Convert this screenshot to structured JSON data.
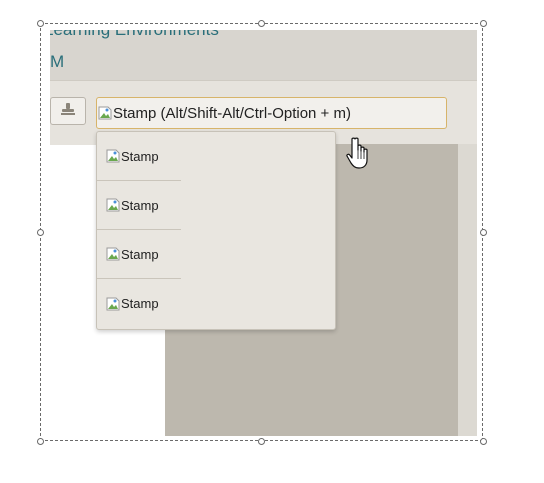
{
  "window": {
    "title_line1": "Learning Environments",
    "title_line2": "M"
  },
  "toolbar": {
    "stamp_tool_icon": "stamp-icon",
    "stamp_button_label": "Stamp (Alt/Shift-Alt/Ctrl-Option + m)",
    "stamp_button_image_alt": "Stamp"
  },
  "dropdown": {
    "items": [
      {
        "label": "Stamp"
      },
      {
        "label": "Stamp"
      },
      {
        "label": "Stamp"
      },
      {
        "label": "Stamp"
      }
    ]
  },
  "colors": {
    "title_text": "#2a6f7a",
    "button_border": "#d7b46a",
    "frame_border": "#6a6a6a"
  }
}
